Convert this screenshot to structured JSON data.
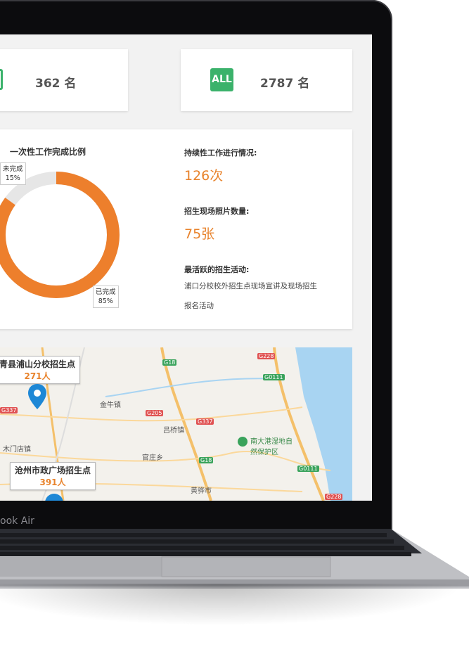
{
  "stats": {
    "left_value": "362 名",
    "right_badge": "ALL",
    "right_value": "2787 名"
  },
  "chart_data": {
    "type": "pie",
    "title": "一次性工作完成比例",
    "slices": [
      {
        "name": "已完成",
        "value": 85,
        "label": "85%",
        "color": "#ed7f2c"
      },
      {
        "name": "未完成",
        "value": 15,
        "label": "15%",
        "color": "#e6e6e6"
      }
    ]
  },
  "info": {
    "continuous_label": "持续性工作进行情况:",
    "continuous_value": "126次",
    "photos_label": "招生现场照片数量:",
    "photos_value": "75张",
    "active_label": "最活跃的招生活动:",
    "active_value": "浦口分校校外招生点现场宣讲及现场招生报名活动"
  },
  "map": {
    "markers": [
      {
        "name": "青县浦山分校招生点",
        "count": "271人"
      },
      {
        "name": "沧州市政广场招生点",
        "count": "391人"
      }
    ],
    "places": [
      "金牛镇",
      "吕桥镇",
      "木门店镇",
      "官庄乡",
      "黄骅市",
      "南大港湿地自然保护区"
    ],
    "roads": [
      "G18",
      "G228",
      "G0111",
      "G337",
      "G205",
      "G337",
      "G18",
      "G0111",
      "G228"
    ]
  },
  "device": {
    "brand": "ook Air"
  }
}
